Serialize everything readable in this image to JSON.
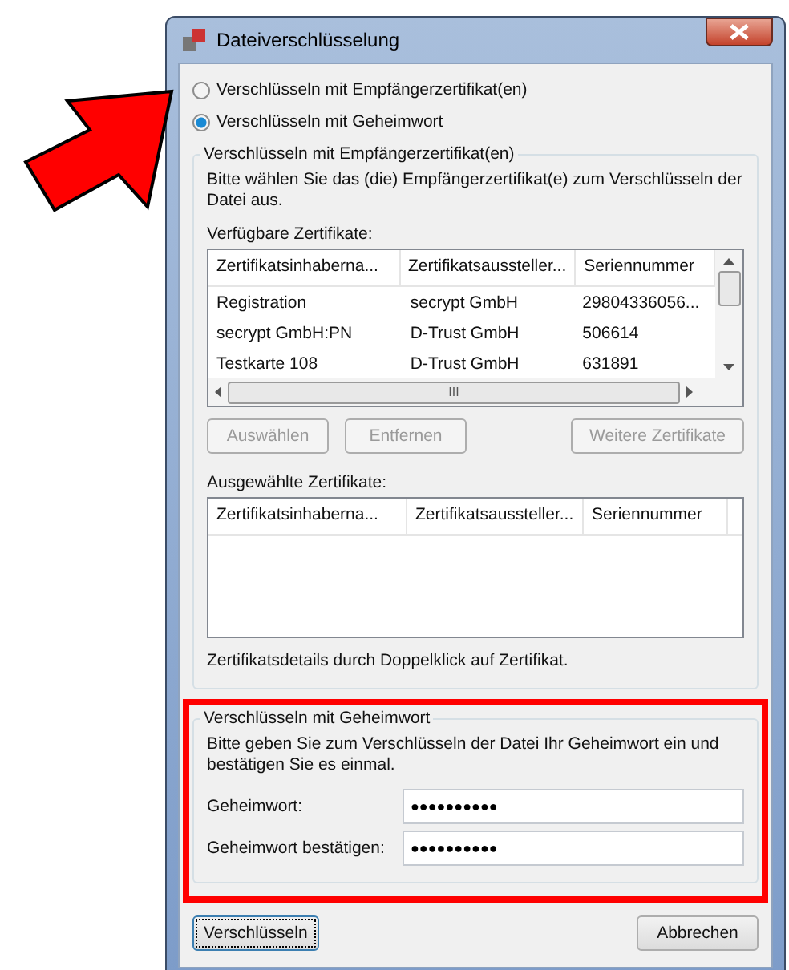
{
  "window": {
    "title": "Dateiverschlüsselung"
  },
  "modes": [
    {
      "label": "Verschlüsseln mit Empfängerzertifikat(en)",
      "selected": false
    },
    {
      "label": "Verschlüsseln mit Geheimwort",
      "selected": true
    }
  ],
  "certificate_group": {
    "title": "Verschlüsseln mit Empfängerzertifikat(en)",
    "instructions": "Bitte wählen Sie das (die) Empfängerzertifikat(e) zum Verschlüsseln der Datei aus.",
    "available_label": "Verfügbare Zertifikate:",
    "available_table": {
      "columns": [
        "Zertifikatsinhaberna...",
        "Zertifikatsaussteller...",
        "Seriennummer"
      ],
      "rows": [
        [
          "Registration",
          "secrypt GmbH",
          "29804336056..."
        ],
        [
          "secrypt GmbH:PN",
          "D-Trust GmbH",
          "506614"
        ],
        [
          "Testkarte 108",
          "D-Trust GmbH",
          "631891"
        ]
      ],
      "hscroll_grip": "III"
    },
    "buttons": [
      {
        "label": "Auswählen",
        "disabled": true
      },
      {
        "label": "Entfernen",
        "disabled": true
      },
      {
        "label": "Weitere Zertifikate",
        "disabled": true
      }
    ],
    "selected_label": "Ausgewählte Zertifikate:",
    "selected_table": {
      "columns": [
        "Zertifikatsinhaberna...",
        "Zertifikatsaussteller...",
        "Seriennummer"
      ]
    },
    "hint": "Zertifikatsdetails durch Doppelklick auf Zertifikat."
  },
  "password_group": {
    "title": "Verschlüsseln mit Geheimwort",
    "instructions": "Bitte geben Sie zum Verschlüsseln der Datei Ihr Geheimwort ein und bestätigen Sie es einmal.",
    "fields": [
      {
        "label": "Geheimwort:",
        "value": "●●●●●●●●●●"
      },
      {
        "label": "Geheimwort bestätigen:",
        "value": "●●●●●●●●●●"
      }
    ]
  },
  "footer_buttons": [
    {
      "label": "Verschlüsseln",
      "default": true
    },
    {
      "label": "Abbrechen",
      "default": false
    }
  ]
}
